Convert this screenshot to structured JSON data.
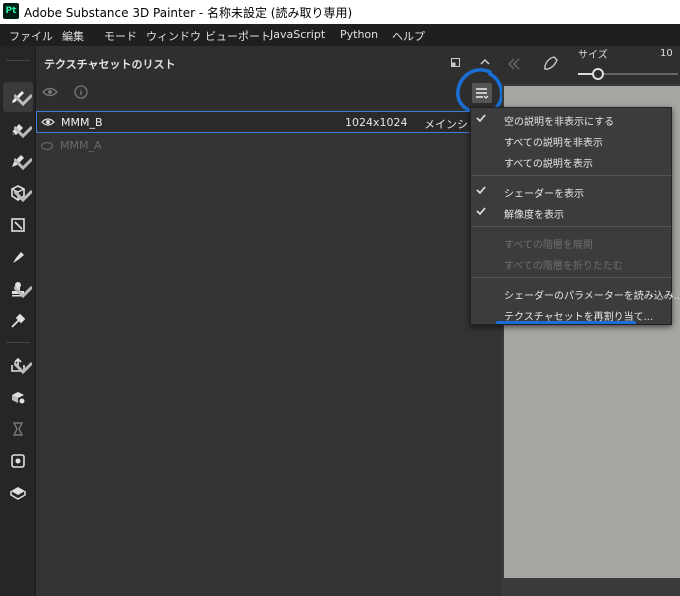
{
  "window": {
    "app_icon": "Pt",
    "title": "Adobe Substance 3D Painter - 名称未設定 (読み取り専用)"
  },
  "menubar": {
    "items": [
      "ファイル",
      "編集",
      "モード",
      "ウィンドウ",
      "ビューポート",
      "JavaScript",
      "Python",
      "ヘルプ"
    ]
  },
  "panel": {
    "title": "テクスチャセットのリスト",
    "rows": [
      {
        "name": "MMM_B",
        "resolution": "1024x1024",
        "shader": "メインシェー",
        "visible": true
      },
      {
        "name": "MMM_A",
        "visible": false
      }
    ]
  },
  "right_panel": {
    "size_label": "サイズ",
    "size_value": "10",
    "size_level": 0.2
  },
  "dropdown": {
    "items": [
      {
        "label": "空の説明を非表示にする",
        "checked": true,
        "disabled": false
      },
      {
        "label": "すべての説明を非表示",
        "checked": false,
        "disabled": false
      },
      {
        "label": "すべての説明を表示",
        "checked": false,
        "disabled": false
      },
      {
        "label": "シェーダーを表示",
        "checked": true,
        "disabled": false
      },
      {
        "label": "解像度を表示",
        "checked": true,
        "disabled": false
      },
      {
        "label": "すべての階層を展開",
        "checked": false,
        "disabled": true
      },
      {
        "label": "すべての階層を折りたたむ",
        "checked": false,
        "disabled": true
      },
      {
        "label": "シェーダーのパラメーターを読み込み...",
        "checked": false,
        "disabled": false
      },
      {
        "label": "テクスチャセットを再割り当て...",
        "checked": false,
        "disabled": false
      }
    ]
  },
  "colors": {
    "annotation": "#1a6fd6",
    "selection_border": "#3d7fd6",
    "viewport": "#a8a6a2"
  },
  "icons": {
    "toolbar": [
      "paint-brush-icon",
      "eraser-icon",
      "projection-icon",
      "geometry-fill-icon",
      "polygon-fill-icon",
      "smudge-icon",
      "clone-stamp-icon",
      "color-picker-icon",
      "export-icon",
      "bake-icon",
      "history-icon",
      "texture-set-settings-icon",
      "display-icon"
    ]
  }
}
